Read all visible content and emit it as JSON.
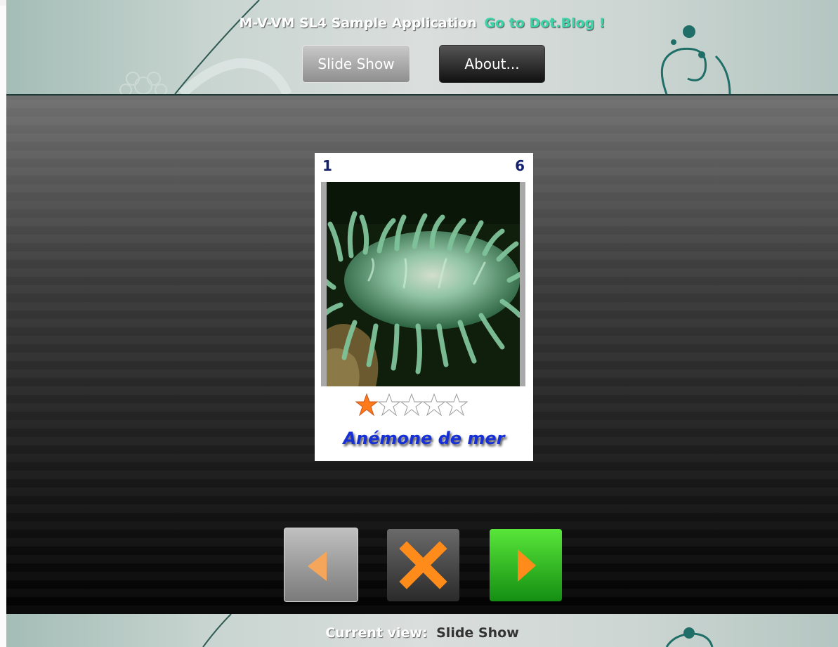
{
  "header": {
    "title": "M-V-VM SL4 Sample Application",
    "link": "Go to Dot.Blog !",
    "nav": [
      {
        "label": "Slide Show"
      },
      {
        "label": "About..."
      }
    ]
  },
  "slide": {
    "index": "1",
    "total": "6",
    "caption": "Anémone de mer",
    "rating": 1,
    "rating_max": 5
  },
  "controls": {
    "prev_icon": "prev-arrow-icon",
    "stop_icon": "close-x-icon",
    "next_icon": "next-arrow-icon"
  },
  "footer": {
    "label": "Current view:",
    "value": "Slide Show"
  },
  "colors": {
    "accent_link": "#3ed3a8",
    "caption": "#1730d6",
    "counter": "#13216e",
    "next_button": "#2fc224",
    "control_glyph": "#ff8c1a"
  }
}
